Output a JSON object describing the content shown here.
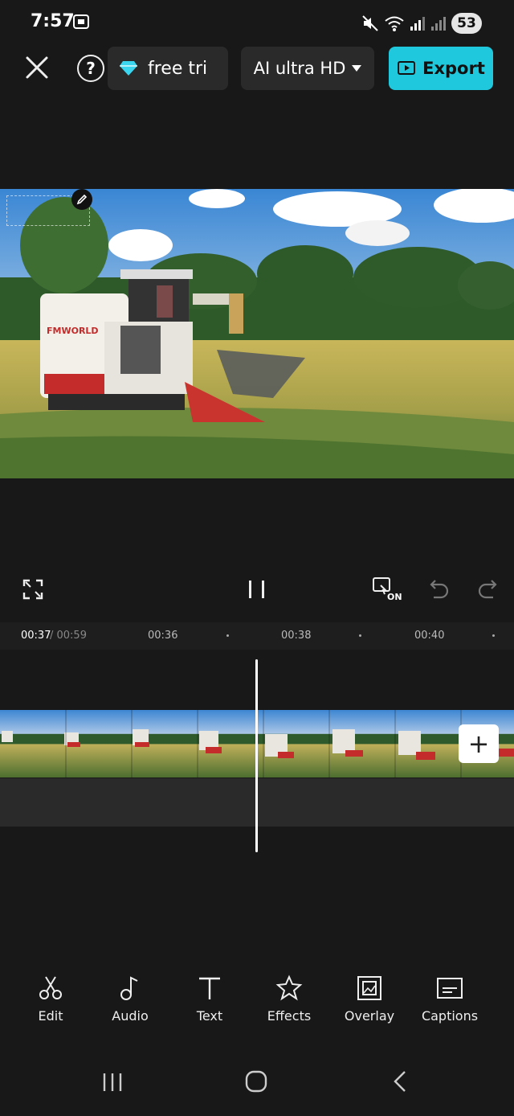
{
  "status_bar": {
    "time": "7:57",
    "battery": "53"
  },
  "top_bar": {
    "trial_label": "free tri",
    "quality_label": "AI ultra HD",
    "export_label": "Export"
  },
  "controls": {
    "proxy_label": "ON"
  },
  "timeline": {
    "current_time": "00:37",
    "total_time": "/ 00:59",
    "ticks": [
      "00:36",
      "00:38",
      "00:40"
    ],
    "add_label": "+"
  },
  "toolbar": {
    "items": [
      {
        "label": "Edit",
        "icon": "scissors-icon"
      },
      {
        "label": "Audio",
        "icon": "music-note-icon"
      },
      {
        "label": "Text",
        "icon": "text-icon"
      },
      {
        "label": "Effects",
        "icon": "effects-star-icon"
      },
      {
        "label": "Overlay",
        "icon": "overlay-icon"
      },
      {
        "label": "Captions",
        "icon": "captions-icon"
      }
    ]
  },
  "preview": {
    "machine_brand": "FMWORLD"
  },
  "colors": {
    "accent": "#1fc8dd",
    "background": "#181818",
    "pill": "#2a2a2a"
  }
}
